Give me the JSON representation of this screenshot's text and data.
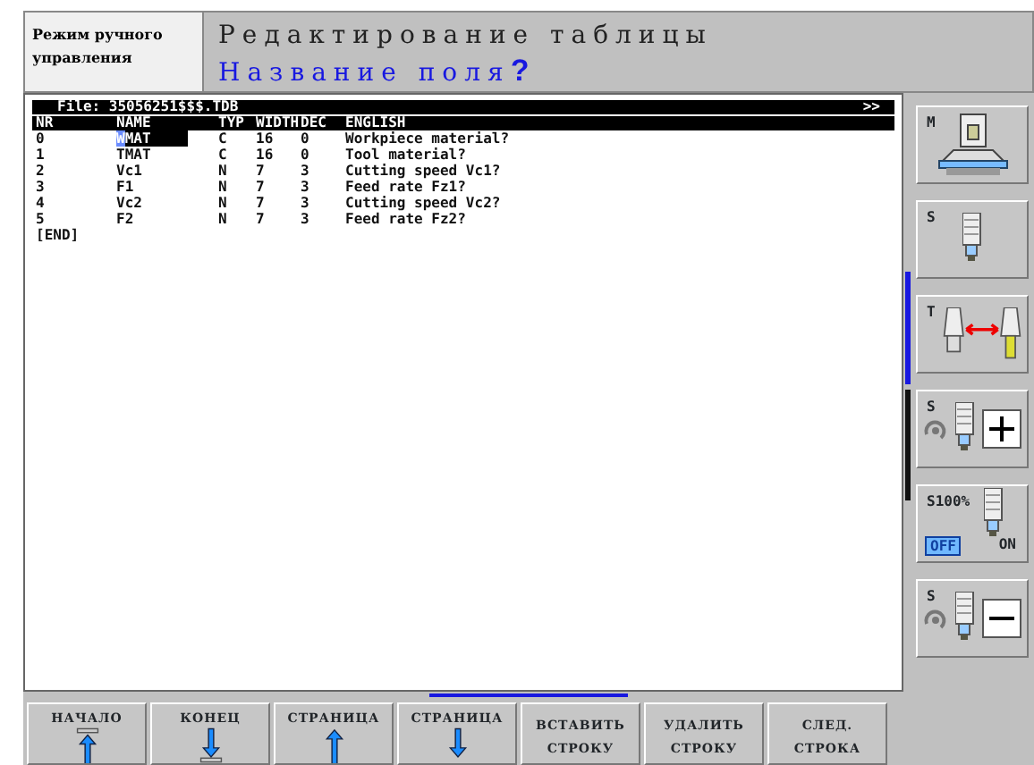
{
  "mode": {
    "text": "Режим ручного управления"
  },
  "title": {
    "heading": "Редактирование таблицы",
    "prompt": "Название поля**?**"
  },
  "table": {
    "file": "File: 35056251$$$.TDB",
    "more": ">>",
    "columns": [
      "NR",
      "NAME",
      "TYP",
      "WIDTH",
      "DEC",
      "ENGLISH"
    ],
    "rows": [
      {
        "cells": [
          "0",
          "WMAT",
          "C",
          "16",
          "0",
          "Workpiece material?"
        ],
        "selected": true
      },
      {
        "cells": [
          "1",
          "TMAT",
          "C",
          "16",
          "0",
          "Tool material?"
        ],
        "selected": false
      },
      {
        "cells": [
          "2",
          "Vc1",
          "N",
          "7",
          "3",
          "Cutting speed Vc1?"
        ],
        "selected": false
      },
      {
        "cells": [
          "3",
          "F1",
          "N",
          "7",
          "3",
          "Feed rate Fz1?"
        ],
        "selected": false
      },
      {
        "cells": [
          "4",
          "Vc2",
          "N",
          "7",
          "3",
          "Cutting speed Vc2?"
        ],
        "selected": false
      },
      {
        "cells": [
          "5",
          "F2",
          "N",
          "7",
          "3",
          "Feed rate Fz2?"
        ],
        "selected": false
      }
    ],
    "end": "[END]"
  },
  "side_keys": [
    {
      "kind": "machine",
      "label": "M"
    },
    {
      "kind": "spindle",
      "label": "S"
    },
    {
      "kind": "tool-change",
      "label": "T"
    },
    {
      "kind": "spindle-plus",
      "label": "S"
    },
    {
      "kind": "spindle-override",
      "label": "S100%",
      "switch": [
        {
          "label": "OFF",
          "selected": true
        },
        {
          "label": "ON",
          "selected": false
        }
      ]
    },
    {
      "kind": "spindle-minus",
      "label": "S"
    }
  ],
  "soft_keys": [
    {
      "kind": "top",
      "lines": [
        "НАЧАЛО"
      ]
    },
    {
      "kind": "bottom",
      "lines": [
        "КОНЕЦ"
      ]
    },
    {
      "kind": "page-up",
      "lines": [
        "СТРАНИЦА"
      ]
    },
    {
      "kind": "page-down",
      "lines": [
        "СТРАНИЦА"
      ]
    },
    {
      "kind": "text",
      "lines": [
        "ВСТАВИТЬ",
        "СТРОКУ"
      ]
    },
    {
      "kind": "text",
      "lines": [
        "УДАЛИТЬ",
        "СТРОКУ"
      ]
    },
    {
      "kind": "text",
      "lines": [
        "СЛЕД.",
        "СТРОКА"
      ]
    }
  ]
}
